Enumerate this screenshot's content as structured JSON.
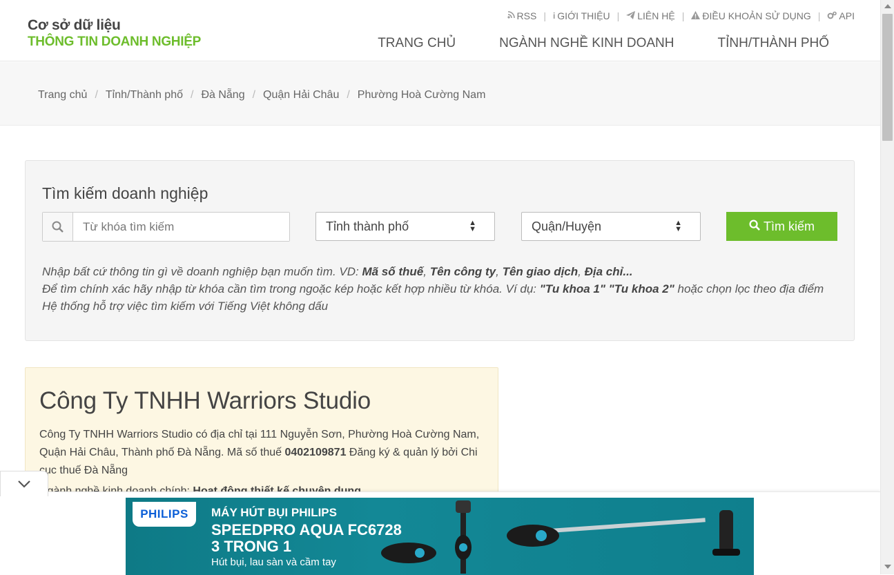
{
  "logo": {
    "line1": "Cơ sở dữ liệu",
    "line2": "THÔNG TIN DOANH NGHIỆP"
  },
  "toplinks": [
    {
      "icon": "rss-icon",
      "label": "RSS"
    },
    {
      "icon": "info-icon",
      "label": "GIỚI THIỆU"
    },
    {
      "icon": "send-icon",
      "label": "LIÊN HỆ"
    },
    {
      "icon": "warning-icon",
      "label": "ĐIỀU KHOẢN SỬ DỤNG"
    },
    {
      "icon": "gears-icon",
      "label": "API"
    }
  ],
  "mainnav": [
    "TRANG CHỦ",
    "NGÀNH NGHỀ KINH DOANH",
    "TỈNH/THÀNH PHỐ"
  ],
  "breadcrumb": [
    "Trang chủ",
    "Tỉnh/Thành phố",
    "Đà Nẵng",
    "Quận Hải Châu",
    "Phường Hoà Cường Nam"
  ],
  "search": {
    "title": "Tìm kiếm doanh nghiệp",
    "placeholder": "Từ khóa tìm kiếm",
    "province_select": "Tỉnh thành phố",
    "district_select": "Quận/Huyện",
    "button": "Tìm kiếm",
    "hint1_pre": "Nhập bất cứ thông tin gì về doanh nghiệp bạn muốn tìm. VD: ",
    "hint1_b1": "Mã số thuế",
    "hint1_b2": "Tên công ty",
    "hint1_b3": "Tên giao dịch",
    "hint1_b4": "Địa chỉ",
    "hint2_pre": "Để tìm chính xác hãy nhập từ khóa cần tìm trong ngoặc kép hoặc kết hợp nhiều từ khóa. Ví dụ: ",
    "hint2_b1": "\"Tu khoa 1\" \"Tu khoa 2\"",
    "hint2_post": " hoặc chọn lọc theo địa điểm",
    "hint3": "Hệ thống hỗ trợ việc tìm kiếm với Tiếng Việt không dấu"
  },
  "company": {
    "name": "Công Ty TNHH Warriors Studio",
    "desc_pre": "Công Ty TNHH Warriors Studio có địa chỉ tại 111 Nguyễn Sơn, Phường Hoà Cường Nam, Quận Hải Châu, Thành phố Đà Nẵng. Mã số thuế ",
    "tax_code": "0402109871",
    "desc_post": " Đăng ký & quản lý bởi Chi cục thuế Đà Nẵng",
    "industry_label": "Ngành nghề kinh doanh chính: ",
    "industry": "Hoạt động thiết kế chuyên dụng"
  },
  "ad": {
    "brand": "PHILIPS",
    "line1": "MÁY HÚT BỤI PHILIPS",
    "line2": "SPEEDPRO AQUA FC6728",
    "line3": "3 TRONG 1",
    "line4": "Hút bụi, lau sàn và cầm tay"
  },
  "colors": {
    "accent": "#6dbd2c",
    "card_bg": "#fdf7e3",
    "ad_bg": "#0f7f8d"
  }
}
